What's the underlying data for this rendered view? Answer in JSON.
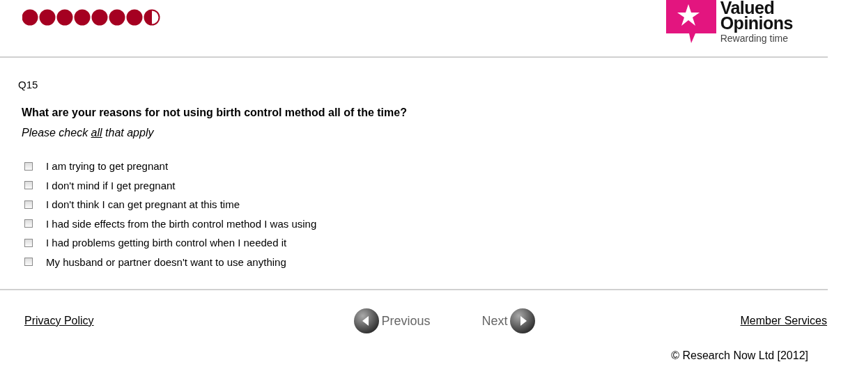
{
  "progress": {
    "steps": [
      {
        "kind": "full"
      },
      {
        "kind": "full"
      },
      {
        "kind": "full"
      },
      {
        "kind": "full"
      },
      {
        "kind": "full"
      },
      {
        "kind": "full"
      },
      {
        "kind": "full"
      },
      {
        "kind": "half"
      }
    ]
  },
  "logo": {
    "name_line_1": "Valued",
    "name_line_2": "Opinions",
    "tagline": "Rewarding time"
  },
  "question": {
    "number": "Q15",
    "text": "What are your reasons for not using birth control method all of the time?",
    "instruction": {
      "before": "Please check ",
      "underlined": "all",
      "after": " that apply"
    }
  },
  "options": [
    {
      "label": "I am trying to get pregnant",
      "checked": false
    },
    {
      "label": "I don't mind if I get pregnant",
      "checked": false
    },
    {
      "label": "I don't think I can get pregnant at this time",
      "checked": false
    },
    {
      "label": "I had side effects from the birth control method I was using",
      "checked": false
    },
    {
      "label": "I had problems getting birth control when I needed it",
      "checked": false
    },
    {
      "label": "My husband or partner doesn't want to use anything",
      "checked": false
    }
  ],
  "footer": {
    "privacy_link": "Privacy Policy",
    "previous_button": "Previous",
    "next_button": "Next",
    "member_link": "Member Services",
    "copyright": "© Research Now Ltd [2012]"
  }
}
